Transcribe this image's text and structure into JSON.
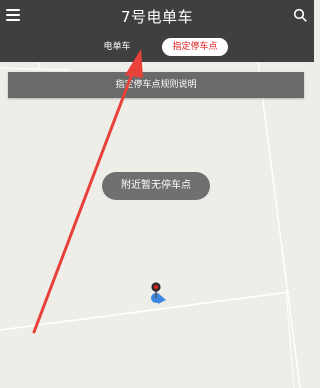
{
  "header": {
    "title": "7号电单车",
    "menu_icon": "hamburger-menu-icon",
    "search_icon": "search-icon",
    "background_color": "#3f3f3f"
  },
  "tabs": [
    {
      "label": "电单车",
      "selected": false
    },
    {
      "label": "指定停车点",
      "selected": true
    }
  ],
  "accent_color": "#e0211f",
  "banner": {
    "text": "指定停车点规则说明"
  },
  "map": {
    "toast": "附近暂无停车点",
    "location_marker_icon": "location-pin-icon",
    "direction_icon": "heading-indicator-icon"
  },
  "annotation": {
    "type": "arrow",
    "color": "#e8413a"
  }
}
